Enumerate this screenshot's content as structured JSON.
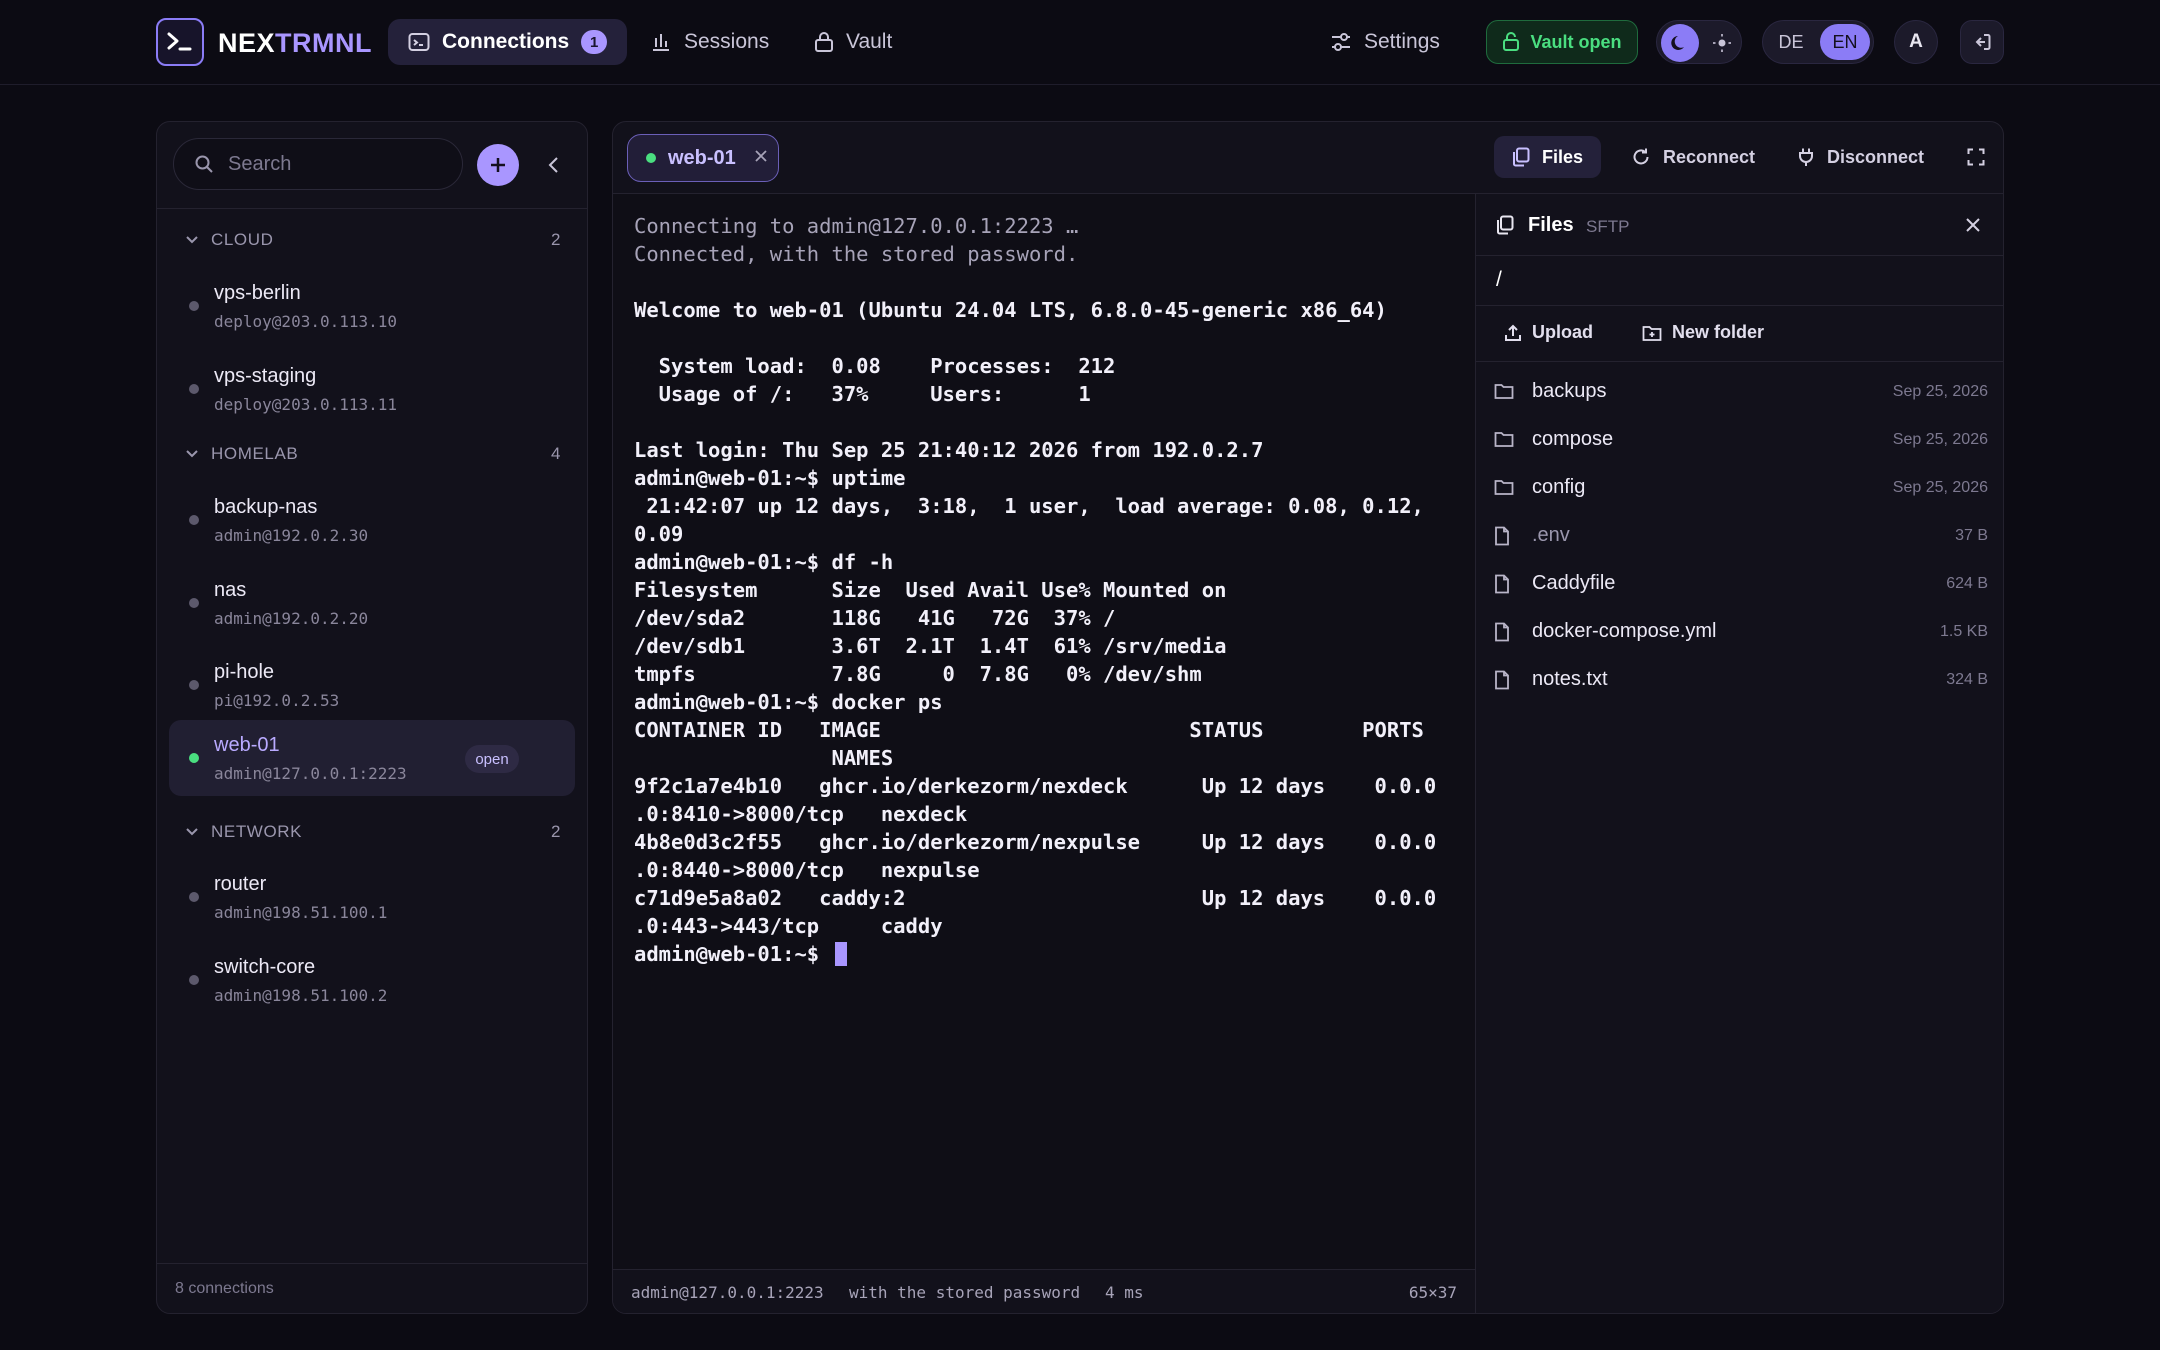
{
  "brand": {
    "part1": "NEX",
    "part2": "TRMNL"
  },
  "nav": {
    "connections": "Connections",
    "connections_count": "1",
    "sessions": "Sessions",
    "vault": "Vault",
    "settings": "Settings",
    "vault_status": "Vault open",
    "lang_de": "DE",
    "lang_en": "EN",
    "avatar_initial": "A"
  },
  "sidebar": {
    "search_placeholder": "Search",
    "groups": [
      {
        "name": "CLOUD",
        "count": "2"
      },
      {
        "name": "HOMELAB",
        "count": "4"
      },
      {
        "name": "NETWORK",
        "count": "2"
      }
    ],
    "hosts": [
      {
        "name": "vps-berlin",
        "addr": "deploy@203.0.113.10"
      },
      {
        "name": "vps-staging",
        "addr": "deploy@203.0.113.11"
      },
      {
        "name": "backup-nas",
        "addr": "admin@192.0.2.30"
      },
      {
        "name": "nas",
        "addr": "admin@192.0.2.20"
      },
      {
        "name": "pi-hole",
        "addr": "pi@192.0.2.53"
      },
      {
        "name": "web-01",
        "addr": "admin@127.0.0.1:2223",
        "badge": "open"
      },
      {
        "name": "router",
        "addr": "admin@198.51.100.1"
      },
      {
        "name": "switch-core",
        "addr": "admin@198.51.100.2"
      }
    ],
    "footer": "8 connections"
  },
  "session": {
    "tab_label": "web-01",
    "files_btn": "Files",
    "reconnect_btn": "Reconnect",
    "disconnect_btn": "Disconnect"
  },
  "terminal": {
    "lines": [
      "Connecting to admin@127.0.0.1:2223 …",
      "Connected, with the stored password.",
      "",
      "Welcome to web-01 (Ubuntu 24.04 LTS, 6.8.0-45-generic x86_64)",
      "",
      "  System load:  0.08    Processes:  212",
      "  Usage of /:   37%     Users:      1",
      "",
      "Last login: Thu Sep 25 21:40:12 2026 from 192.0.2.7",
      "admin@web-01:~$ uptime",
      " 21:42:07 up 12 days,  3:18,  1 user,  load average: 0.08, 0.12,",
      "0.09",
      "admin@web-01:~$ df -h",
      "Filesystem      Size  Used Avail Use% Mounted on",
      "/dev/sda2       118G   41G   72G  37% /",
      "/dev/sdb1       3.6T  2.1T  1.4T  61% /srv/media",
      "tmpfs           7.8G     0  7.8G   0% /dev/shm",
      "admin@web-01:~$ docker ps",
      "CONTAINER ID   IMAGE                         STATUS        PORTS",
      "                NAMES",
      "9f2c1a7e4b10   ghcr.io/derkezorm/nexdeck      Up 12 days    0.0.0",
      ".0:8410->8000/tcp   nexdeck",
      "4b8e0d3c2f55   ghcr.io/derkezorm/nexpulse     Up 12 days    0.0.0",
      ".0:8440->8000/tcp   nexpulse",
      "c71d9e5a8a02   caddy:2                        Up 12 days    0.0.0",
      ".0:443->443/tcp     caddy"
    ],
    "prompt": "admin@web-01:~$ ",
    "status_host": "admin@127.0.0.1:2223",
    "status_auth": "with the stored password",
    "status_latency": "4 ms",
    "status_size": "65×37"
  },
  "files": {
    "title": "Files",
    "subtitle": "SFTP",
    "path": "/",
    "upload": "Upload",
    "new_folder": "New folder",
    "entries": [
      {
        "name": "backups",
        "meta": "Sep 25, 2026",
        "kind": "folder"
      },
      {
        "name": "compose",
        "meta": "Sep 25, 2026",
        "kind": "folder"
      },
      {
        "name": "config",
        "meta": "Sep 25, 2026",
        "kind": "folder"
      },
      {
        "name": ".env",
        "meta": "37 B",
        "kind": "file"
      },
      {
        "name": "Caddyfile",
        "meta": "624 B",
        "kind": "file"
      },
      {
        "name": "docker-compose.yml",
        "meta": "1.5 KB",
        "kind": "file"
      },
      {
        "name": "notes.txt",
        "meta": "324 B",
        "kind": "file"
      }
    ]
  },
  "colors": {
    "accent": "#a996ff",
    "online": "#4ade80",
    "background": "#0c0b13"
  }
}
